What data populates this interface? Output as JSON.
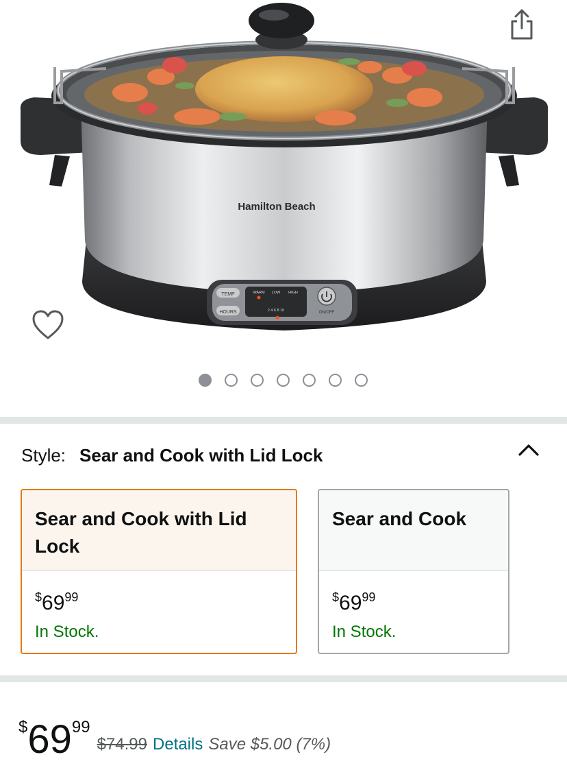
{
  "product_image": {
    "brand_text": "Hamilton Beach",
    "panel_labels": {
      "temp": "TEMP",
      "hours": "HOURS",
      "warm": "WARM",
      "low": "LOW",
      "high": "HIGH",
      "on_off": "ON/OFF",
      "hour_marks": "2 4 6 8 10"
    }
  },
  "gallery": {
    "image_count": 7,
    "active_index": 0
  },
  "style_selector": {
    "label": "Style:",
    "selected_value": "Sear and Cook with Lid Lock",
    "options": [
      {
        "name": "Sear and Cook with Lid Lock",
        "price_symbol": "$",
        "price_whole": "69",
        "price_cents": "99",
        "availability": "In Stock.",
        "selected": true
      },
      {
        "name": "Sear and Cook",
        "price_symbol": "$",
        "price_whole": "69",
        "price_cents": "99",
        "availability": "In Stock.",
        "selected": false
      }
    ]
  },
  "price": {
    "symbol": "$",
    "whole": "69",
    "cents": "99",
    "list_price": "$74.99",
    "details_label": "Details",
    "savings": "Save $5.00 (7%)"
  },
  "colors": {
    "accent_selected": "#e47911",
    "in_stock": "#007600",
    "link": "#007185"
  }
}
